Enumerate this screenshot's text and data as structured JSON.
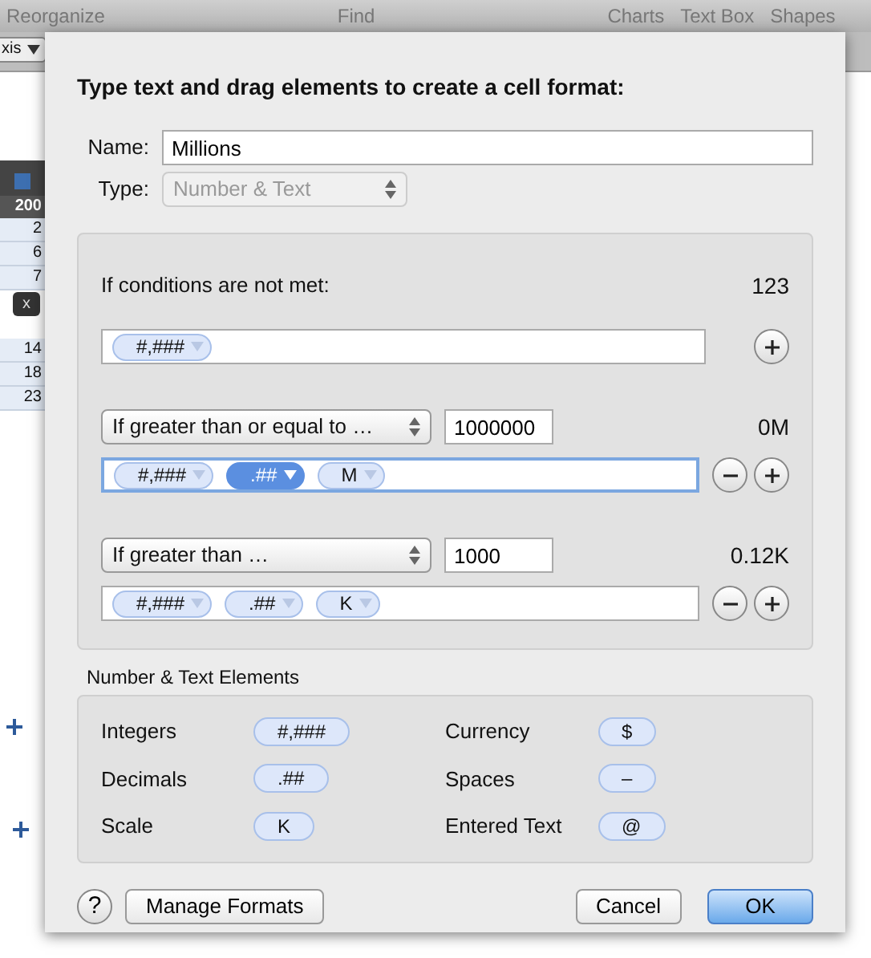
{
  "app_toolbar": {
    "items": [
      "Reorganize",
      "Find",
      "Charts",
      "Text Box",
      "Shapes"
    ]
  },
  "background": {
    "popup": "xis",
    "column_header": "200",
    "cells": [
      "2",
      "6",
      "7",
      "14",
      "18",
      "23"
    ],
    "tooltip": "x"
  },
  "dialog": {
    "title": "Type text and drag elements to create a cell format:",
    "name": {
      "label": "Name:",
      "value": "Millions"
    },
    "type": {
      "label": "Type:",
      "value": "Number & Text",
      "disabled": true
    },
    "default_rule": {
      "label": "If conditions are not met:",
      "preview": "123",
      "tokens": [
        {
          "text": "#,###",
          "selected": false
        }
      ]
    },
    "conditions": [
      {
        "condition": "If greater than or equal to …",
        "value": "1000000",
        "preview": "0M",
        "focused": true,
        "tokens": [
          {
            "text": "#,###",
            "selected": false
          },
          {
            "text": ".##",
            "selected": true
          },
          {
            "text": "M",
            "selected": false
          }
        ]
      },
      {
        "condition": "If greater than …",
        "value": "1000",
        "preview": "0.12K",
        "focused": false,
        "tokens": [
          {
            "text": "#,###",
            "selected": false
          },
          {
            "text": ".##",
            "selected": false
          },
          {
            "text": "K",
            "selected": false
          }
        ]
      }
    ],
    "elements": {
      "title": "Number & Text Elements",
      "items": [
        {
          "label": "Integers",
          "token": "#,###"
        },
        {
          "label": "Currency",
          "token": "$"
        },
        {
          "label": "Decimals",
          "token": ".##"
        },
        {
          "label": "Spaces",
          "token": "–"
        },
        {
          "label": "Scale",
          "token": "K"
        },
        {
          "label": "Entered Text",
          "token": "@"
        }
      ]
    },
    "help": "?",
    "buttons": [
      {
        "label": "Manage Formats",
        "default": false
      },
      {
        "label": "Cancel",
        "default": false
      },
      {
        "label": "OK",
        "default": true
      }
    ]
  }
}
